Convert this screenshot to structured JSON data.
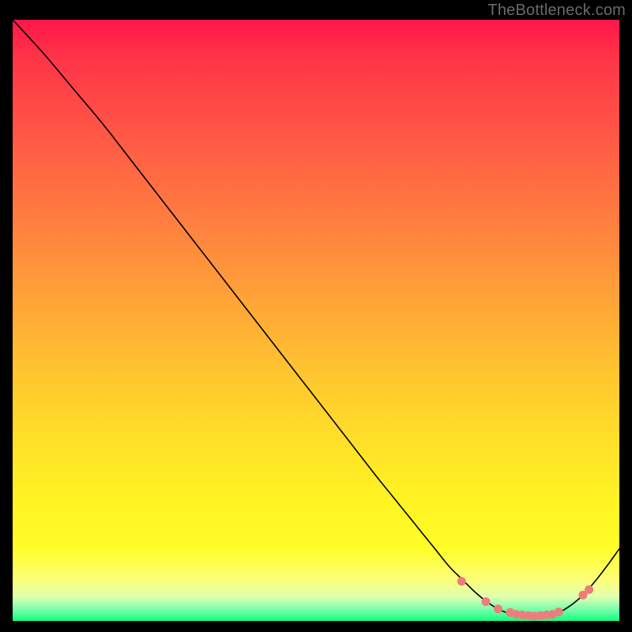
{
  "watermark": "TheBottleneck.com",
  "chart_data": {
    "type": "line",
    "title": "",
    "xlabel": "",
    "ylabel": "",
    "xlim": [
      0,
      100
    ],
    "ylim": [
      0,
      100
    ],
    "grid": false,
    "series": [
      {
        "name": "bottleneck-curve",
        "color": "#000000",
        "x": [
          0,
          5,
          10,
          15,
          20,
          25,
          30,
          35,
          40,
          45,
          50,
          55,
          60,
          62,
          64,
          66,
          68,
          70,
          72,
          74,
          76,
          78,
          80,
          82,
          84,
          86,
          88,
          90,
          92,
          94,
          96,
          98,
          100
        ],
        "y": [
          100,
          94.5,
          88.5,
          82.5,
          76,
          69.5,
          63,
          56.5,
          50,
          43.5,
          37,
          30.5,
          24,
          21.5,
          19,
          16.5,
          14,
          11.5,
          9,
          7,
          5,
          3.3,
          2,
          1.2,
          0.8,
          0.7,
          0.9,
          1.4,
          2.6,
          4.3,
          6.6,
          9.2,
          12
        ]
      }
    ],
    "highlight": {
      "name": "optimal-range",
      "color": "#ef7c7c",
      "x": [
        74,
        78,
        80,
        82,
        83,
        84,
        85,
        86,
        87,
        88,
        89,
        90,
        94,
        95
      ],
      "y": [
        6.6,
        3.2,
        2.0,
        1.4,
        1.1,
        1.0,
        0.9,
        0.8,
        0.9,
        1.0,
        1.1,
        1.5,
        4.3,
        5.2
      ]
    },
    "background_gradient": {
      "direction": "vertical",
      "stops": [
        {
          "pos": 0.0,
          "color": "#ff154a"
        },
        {
          "pos": 0.2,
          "color": "#ff5a45"
        },
        {
          "pos": 0.46,
          "color": "#ffa238"
        },
        {
          "pos": 0.7,
          "color": "#ffe028"
        },
        {
          "pos": 0.88,
          "color": "#fffe28"
        },
        {
          "pos": 0.96,
          "color": "#dfffb0"
        },
        {
          "pos": 1.0,
          "color": "#10ff80"
        }
      ]
    }
  }
}
